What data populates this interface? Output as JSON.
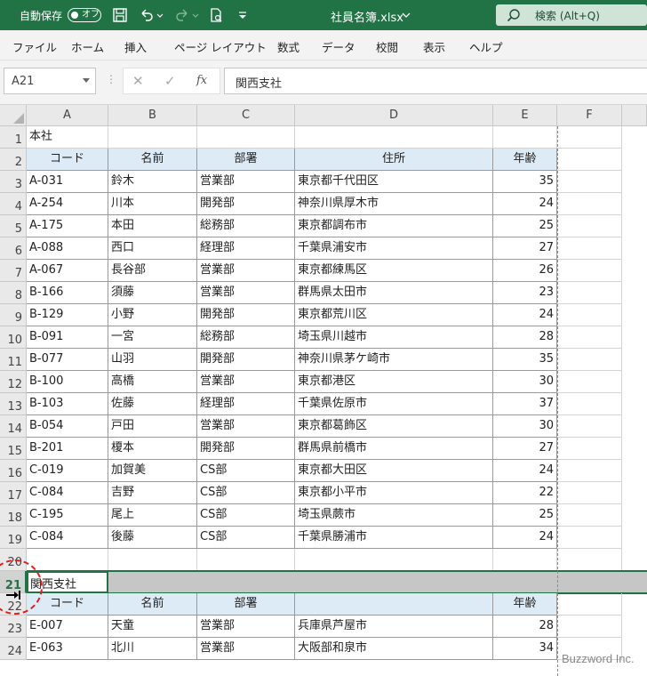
{
  "titlebar": {
    "autosave_label": "自動保存",
    "autosave_state": "オフ",
    "filename": "社員名簿.xlsx",
    "search_placeholder": "検索 (Alt+Q)"
  },
  "menu": [
    "ファイル",
    "ホーム",
    "挿入",
    "ページ レイアウト",
    "数式",
    "データ",
    "校閲",
    "表示",
    "ヘルプ"
  ],
  "formula_bar": {
    "name_box": "A21",
    "formula": "関西支社"
  },
  "columns": [
    "A",
    "B",
    "C",
    "D",
    "E",
    "F"
  ],
  "rows": [
    {
      "n": "1",
      "title": "本社"
    },
    {
      "n": "2",
      "header": [
        "コード",
        "名前",
        "部署",
        "住所",
        "年齢"
      ]
    },
    {
      "n": "3",
      "cells": [
        "A-031",
        "鈴木",
        "営業部",
        "東京都千代田区",
        "35"
      ]
    },
    {
      "n": "4",
      "cells": [
        "A-254",
        "川本",
        "開発部",
        "神奈川県厚木市",
        "24"
      ]
    },
    {
      "n": "5",
      "cells": [
        "A-175",
        "本田",
        "総務部",
        "東京都調布市",
        "25"
      ]
    },
    {
      "n": "6",
      "cells": [
        "A-088",
        "西口",
        "経理部",
        "千葉県浦安市",
        "27"
      ]
    },
    {
      "n": "7",
      "cells": [
        "A-067",
        "長谷部",
        "営業部",
        "東京都練馬区",
        "26"
      ]
    },
    {
      "n": "8",
      "cells": [
        "B-166",
        "須藤",
        "営業部",
        "群馬県太田市",
        "23"
      ]
    },
    {
      "n": "9",
      "cells": [
        "B-129",
        "小野",
        "開発部",
        "東京都荒川区",
        "24"
      ]
    },
    {
      "n": "10",
      "cells": [
        "B-091",
        "一宮",
        "総務部",
        "埼玉県川越市",
        "28"
      ]
    },
    {
      "n": "11",
      "cells": [
        "B-077",
        "山羽",
        "開発部",
        "神奈川県茅ケ崎市",
        "35"
      ]
    },
    {
      "n": "12",
      "cells": [
        "B-100",
        "高橋",
        "営業部",
        "東京都港区",
        "30"
      ]
    },
    {
      "n": "13",
      "cells": [
        "B-103",
        "佐藤",
        "経理部",
        "千葉県佐原市",
        "37"
      ]
    },
    {
      "n": "14",
      "cells": [
        "B-054",
        "戸田",
        "営業部",
        "東京都葛飾区",
        "30"
      ]
    },
    {
      "n": "15",
      "cells": [
        "B-201",
        "榎本",
        "開発部",
        "群馬県前橋市",
        "27"
      ]
    },
    {
      "n": "16",
      "cells": [
        "C-019",
        "加賀美",
        "CS部",
        "東京都大田区",
        "24"
      ]
    },
    {
      "n": "17",
      "cells": [
        "C-084",
        "吉野",
        "CS部",
        "東京都小平市",
        "22"
      ]
    },
    {
      "n": "18",
      "cells": [
        "C-195",
        "尾上",
        "CS部",
        "埼玉県蕨市",
        "25"
      ]
    },
    {
      "n": "19",
      "cells": [
        "C-084",
        "後藤",
        "CS部",
        "千葉県勝浦市",
        "24"
      ]
    },
    {
      "n": "20",
      "blank": true
    },
    {
      "n": "21",
      "title": "関西支社",
      "selected": true
    },
    {
      "n": "22",
      "header": [
        "コード",
        "名前",
        "部署",
        "",
        "年齢"
      ]
    },
    {
      "n": "23",
      "cells": [
        "E-007",
        "天童",
        "営業部",
        "兵庫県芦屋市",
        "28"
      ]
    },
    {
      "n": "24",
      "cells": [
        "E-063",
        "北川",
        "営業部",
        "大阪部和泉市",
        "34"
      ]
    }
  ],
  "watermark": "Buzzword Inc.",
  "colors": {
    "accent": "#217346",
    "header_fill": "#ddebf7",
    "selected_row_fill": "#c6c6c6",
    "annotation_circle": "#e02020"
  }
}
